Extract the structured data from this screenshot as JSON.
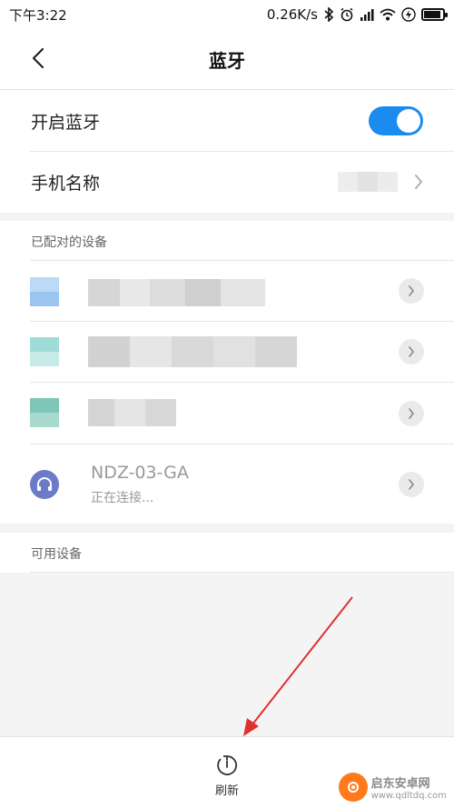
{
  "status": {
    "time": "下午3:22",
    "speed": "0.26K/s",
    "battery_level": 0.9
  },
  "header": {
    "title": "蓝牙"
  },
  "settings": {
    "bluetooth_label": "开启蓝牙",
    "bluetooth_on": true,
    "phone_name_label": "手机名称"
  },
  "paired": {
    "section_label": "已配对的设备",
    "devices": [
      {
        "name": "NDZ-03-GA",
        "status": "正在连接..."
      }
    ]
  },
  "available": {
    "section_label": "可用设备"
  },
  "bottom": {
    "refresh_label": "刷新"
  },
  "watermark": {
    "title": "启东安卓网",
    "url": "www.qdltdq.com"
  },
  "colors": {
    "accent": "#1a8cf0",
    "headset": "#6b7bc9",
    "annotation_arrow": "#e03030"
  }
}
